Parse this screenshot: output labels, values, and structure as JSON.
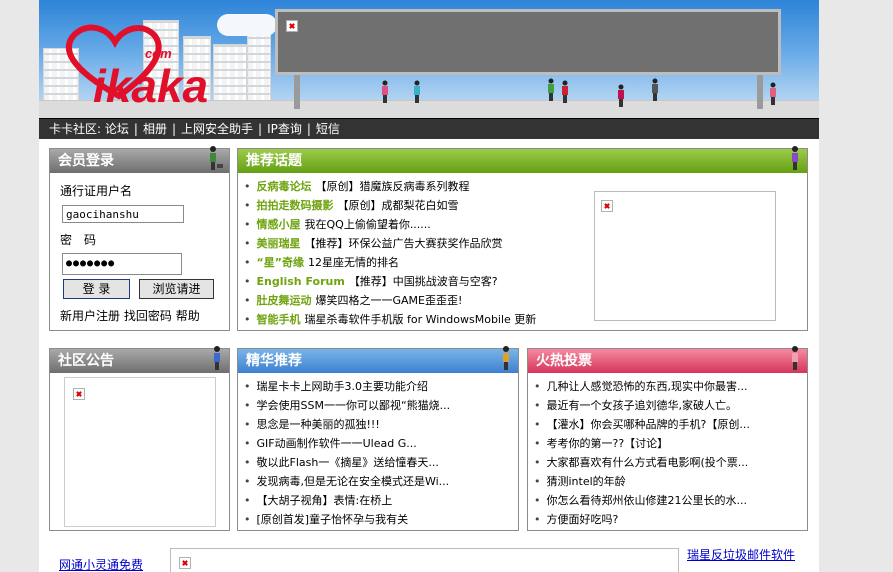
{
  "logo": {
    "text": "ikaka",
    "suffix": "com"
  },
  "topnav": {
    "prefix": "卡卡社区:",
    "items": [
      "论坛",
      "相册",
      "上网安全助手",
      "IP查询",
      "短信"
    ]
  },
  "login": {
    "title": "会员登录",
    "username_label": "通行证用户名",
    "username_value": "gaocihanshu",
    "password_label": "密　码",
    "password_value": "●●●●●●●",
    "login_button": "登 录",
    "browse_button": "浏览请进",
    "links": [
      "新用户注册",
      "找回密码",
      "帮助"
    ]
  },
  "recommend": {
    "title": "推荐话题",
    "items": [
      {
        "forum": "反病毒论坛",
        "text": "【原创】猎魔族反病毒系列教程"
      },
      {
        "forum": "拍拍走数码摄影",
        "text": "【原创】成都梨花白如雪"
      },
      {
        "forum": "情感小屋",
        "text": "我在QQ上偷偷望着你......"
      },
      {
        "forum": "美丽瑞星",
        "text": "【推荐】环保公益广告大赛获奖作品欣赏"
      },
      {
        "forum": "“星”奇缘",
        "text": "12星座无情的排名"
      },
      {
        "forum": "English Forum",
        "text": "【推荐】中国挑战波音与空客?"
      },
      {
        "forum": "肚皮舞运动",
        "text": "爆笑四格之一一GAME歪歪歪!"
      },
      {
        "forum": "智能手机",
        "text": "瑞星杀毒软件手机版 for WindowsMobile 更新"
      }
    ]
  },
  "notice": {
    "title": "社区公告"
  },
  "featured": {
    "title": "精华推荐",
    "items": [
      "瑞星卡卡上网助手3.0主要功能介绍",
      "学会使用SSM一一你可以鄙视“熊猫烧...",
      "思念是一种美丽的孤独!!!",
      "GIF动画制作软件一一Ulead G...",
      "敬以此Flash一《摘星》送给憧春天...",
      "发现病毒,但是无论在安全模式还是Wi...",
      "【大胡子视角】表情:在桥上",
      "[原创首发]童子怡怀孕与我有关"
    ]
  },
  "hot": {
    "title": "火热投票",
    "items": [
      "几种让人感觉恐怖的东西,现实中你最害...",
      "最近有一个女孩子追刘德华,家破人亡。",
      "【灌水】你会买哪种品牌的手机?【原创...",
      "考考你的第一??【讨论】",
      "大家都喜欢有什么方式看电影啊(投个票...",
      "猜测intel的年龄",
      "你怎么看待郑州依山修建21公里长的水...",
      "方便面好吃吗?"
    ]
  },
  "bottom": {
    "left_link": "网通小灵通免费",
    "right_link": "瑞星反垃圾邮件软件"
  },
  "colors": {
    "nav_bg": "#333333",
    "forum_green": "#6fa410",
    "logo_red": "#e0102a",
    "link_blue": "#0000cc"
  }
}
